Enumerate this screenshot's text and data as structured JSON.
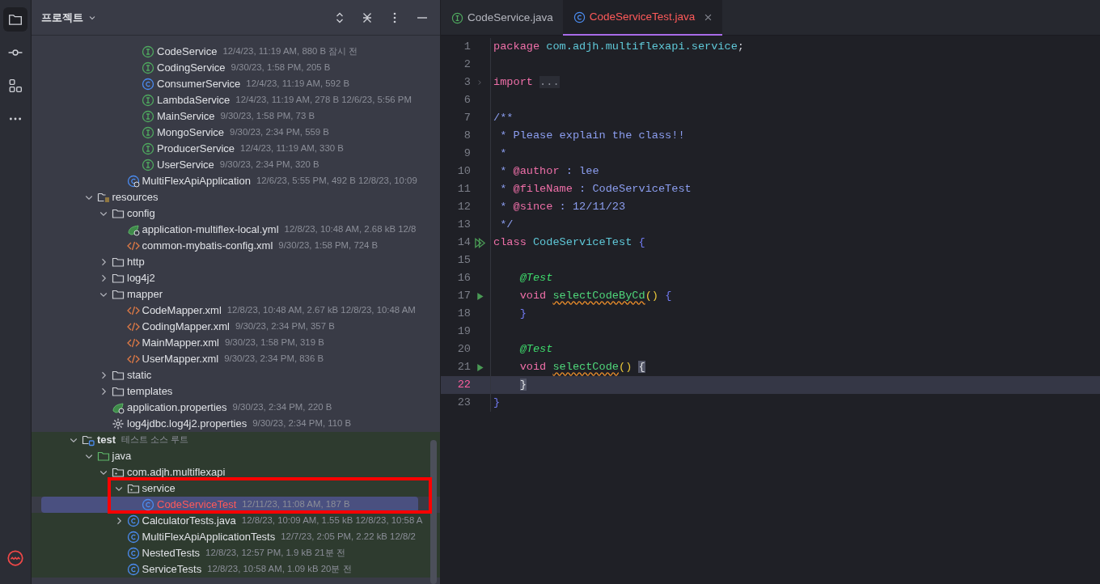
{
  "toolstrip": {
    "items": [
      {
        "selected": true
      },
      {
        "selected": false
      },
      {
        "selected": false
      },
      {
        "selected": false
      }
    ]
  },
  "project_panel": {
    "title": "프로젝트",
    "tree": [
      {
        "children": [
          {
            "children": [
              {
                "children": [
                  {
                    "children": [
                      {
                        "label": "CodeService",
                        "meta": "12/4/23, 11:19 AM, 880 B 잠시 전",
                        "kind": "interface",
                        "selected": false
                      },
                      {
                        "label": "CodingService",
                        "meta": "9/30/23, 1:58 PM, 205 B",
                        "kind": "interface",
                        "selected": false
                      },
                      {
                        "label": "ConsumerService",
                        "meta": "12/4/23, 11:19 AM, 592 B",
                        "kind": "class",
                        "selected": false
                      },
                      {
                        "label": "LambdaService",
                        "meta": "12/4/23, 11:19 AM, 278 B 12/6/23, 5:56 PM",
                        "kind": "interface",
                        "selected": false
                      },
                      {
                        "label": "MainService",
                        "meta": "9/30/23, 1:58 PM, 73 B",
                        "kind": "interface",
                        "selected": false
                      },
                      {
                        "label": "MongoService",
                        "meta": "9/30/23, 2:34 PM, 559 B",
                        "kind": "interface",
                        "selected": false
                      },
                      {
                        "label": "ProducerService",
                        "meta": "12/4/23, 11:19 AM, 330 B",
                        "kind": "interface",
                        "selected": false
                      },
                      {
                        "label": "UserService",
                        "meta": "9/30/23, 2:34 PM, 320 B",
                        "kind": "interface",
                        "selected": false
                      }
                    ]
                  },
                  {
                    "label": "MultiFlexApiApplication",
                    "meta": "12/6/23, 5:55 PM, 492 B 12/8/23, 10:09",
                    "kind": "bootclass",
                    "selected": false
                  }
                ]
              }
            ]
          },
          {
            "label": "resources",
            "kind": "resources",
            "expanded": true,
            "selected": false,
            "children": [
              {
                "label": "config",
                "kind": "folder",
                "expanded": true,
                "selected": false,
                "children": [
                  {
                    "label": "application-multiflex-local.yml",
                    "meta": "12/8/23, 10:48 AM, 2.68 kB 12/8",
                    "kind": "springconfig",
                    "selected": false
                  },
                  {
                    "label": "common-mybatis-config.xml",
                    "meta": "9/30/23, 1:58 PM, 724 B",
                    "kind": "xml",
                    "selected": false
                  }
                ]
              },
              {
                "label": "http",
                "kind": "folder",
                "expanded": false,
                "selected": false
              },
              {
                "label": "log4j2",
                "kind": "folder",
                "expanded": false,
                "selected": false
              },
              {
                "label": "mapper",
                "kind": "folder",
                "expanded": true,
                "selected": false,
                "children": [
                  {
                    "label": "CodeMapper.xml",
                    "meta": "12/8/23, 10:48 AM, 2.67 kB 12/8/23, 10:48 AM",
                    "kind": "xml",
                    "selected": false
                  },
                  {
                    "label": "CodingMapper.xml",
                    "meta": "9/30/23, 2:34 PM, 357 B",
                    "kind": "xml",
                    "selected": false
                  },
                  {
                    "label": "MainMapper.xml",
                    "meta": "9/30/23, 1:58 PM, 319 B",
                    "kind": "xml",
                    "selected": false
                  },
                  {
                    "label": "UserMapper.xml",
                    "meta": "9/30/23, 2:34 PM, 836 B",
                    "kind": "xml",
                    "selected": false
                  }
                ]
              },
              {
                "label": "static",
                "kind": "folder",
                "expanded": false,
                "selected": false
              },
              {
                "label": "templates",
                "kind": "folder",
                "expanded": false,
                "selected": false
              },
              {
                "label": "application.properties",
                "meta": "9/30/23, 2:34 PM, 220 B",
                "kind": "springconfig",
                "selected": false
              },
              {
                "label": "log4jdbc.log4j2.properties",
                "meta": "9/30/23, 2:34 PM, 110 B",
                "kind": "properties",
                "selected": false
              }
            ]
          }
        ]
      },
      {
        "label": "test",
        "meta": "테스트 소스 루트",
        "kind": "testroot",
        "expanded": true,
        "selected": false,
        "children": [
          {
            "label": "java",
            "kind": "source",
            "expanded": true,
            "selected": false,
            "children": [
              {
                "label": "com.adjh.multiflexapi",
                "kind": "package",
                "expanded": true,
                "selected": false,
                "children": [
                  {
                    "label": "service",
                    "kind": "package",
                    "expanded": true,
                    "selected": false,
                    "framed": true,
                    "children": [
                      {
                        "label": "CodeServiceTest",
                        "meta": "12/11/23, 11:08 AM, 187 B",
                        "kind": "class",
                        "selected": true,
                        "added": true
                      }
                    ]
                  },
                  {
                    "label": "CalculatorTests.java",
                    "meta": "12/8/23, 10:09 AM, 1.55 kB 12/8/23, 10:58 A",
                    "kind": "class",
                    "expanded": false,
                    "selected": false
                  },
                  {
                    "label": "MultiFlexApiApplicationTests",
                    "meta": "12/7/23, 2:05 PM, 2.22 kB 12/8/2",
                    "kind": "class",
                    "selected": false
                  },
                  {
                    "label": "NestedTests",
                    "meta": "12/8/23, 12:57 PM, 1.9 kB 21분 전",
                    "kind": "class",
                    "selected": false
                  },
                  {
                    "label": "ServiceTests",
                    "meta": "12/8/23, 10:58 AM, 1.09 kB 20분 전",
                    "kind": "class",
                    "selected": false
                  }
                ]
              }
            ]
          }
        ]
      }
    ]
  },
  "editor": {
    "tabs": [
      {
        "label": "CodeService.java",
        "kind": "interface",
        "selected": false
      },
      {
        "label": "CodeServiceTest.java",
        "kind": "class",
        "selected": true,
        "added": true,
        "closable": true
      }
    ],
    "lines": [
      {
        "n": "1",
        "tokens": [
          {
            "kind": "keyword",
            "text": "package "
          },
          {
            "kind": "name",
            "text": "com.adjh.multiflexapi.service"
          },
          {
            "kind": "plain",
            "text": ";"
          }
        ]
      },
      {
        "n": "2"
      },
      {
        "n": "3",
        "kind": "fold",
        "tokens": [
          {
            "kind": "keyword",
            "text": "import "
          },
          {
            "kind": "folded",
            "text": "..."
          }
        ]
      },
      {
        "n": "6"
      },
      {
        "n": "7",
        "tokens": [
          {
            "kind": "comment",
            "text": "/**"
          }
        ]
      },
      {
        "n": "8",
        "tokens": [
          {
            "kind": "comment",
            "text": " * Please explain the class!!"
          }
        ]
      },
      {
        "n": "9",
        "tokens": [
          {
            "kind": "comment",
            "text": " *"
          }
        ]
      },
      {
        "n": "10",
        "tokens": [
          {
            "kind": "comment",
            "text": " * "
          },
          {
            "kind": "doctag",
            "text": "@author"
          },
          {
            "kind": "comment",
            "text": " : lee"
          }
        ]
      },
      {
        "n": "11",
        "tokens": [
          {
            "kind": "comment",
            "text": " * "
          },
          {
            "kind": "doctag",
            "text": "@fileName"
          },
          {
            "kind": "comment",
            "text": " : CodeServiceTest"
          }
        ]
      },
      {
        "n": "12",
        "tokens": [
          {
            "kind": "comment",
            "text": " * "
          },
          {
            "kind": "doctag",
            "text": "@since"
          },
          {
            "kind": "comment",
            "text": " : 12/11/23"
          }
        ]
      },
      {
        "n": "13",
        "tokens": [
          {
            "kind": "comment",
            "text": " */"
          }
        ]
      },
      {
        "n": "14",
        "kind": "runall",
        "tokens": [
          {
            "kind": "keyword",
            "text": "class "
          },
          {
            "kind": "name",
            "text": "CodeServiceTest "
          },
          {
            "kind": "brace",
            "text": "{"
          }
        ]
      },
      {
        "n": "15"
      },
      {
        "n": "16",
        "tokens": [
          {
            "kind": "annotation",
            "text": "    @Test"
          }
        ]
      },
      {
        "n": "17",
        "kind": "run",
        "tokens": [
          {
            "kind": "keyword",
            "text": "    void "
          },
          {
            "kind": "warning",
            "text": "selectCodeByCd"
          },
          {
            "kind": "paren",
            "text": "() "
          },
          {
            "kind": "brace",
            "text": "{"
          }
        ]
      },
      {
        "n": "18",
        "tokens": [
          {
            "kind": "brace",
            "text": "    }"
          }
        ]
      },
      {
        "n": "19"
      },
      {
        "n": "20",
        "tokens": [
          {
            "kind": "annotation",
            "text": "    @Test"
          }
        ]
      },
      {
        "n": "21",
        "kind": "run",
        "tokens": [
          {
            "kind": "keyword",
            "text": "    void "
          },
          {
            "kind": "warning",
            "text": "selectCode"
          },
          {
            "kind": "paren",
            "text": "() "
          },
          {
            "kind": "match",
            "text": "{"
          }
        ]
      },
      {
        "n": "22",
        "current": true,
        "tokens": [
          {
            "kind": "match",
            "text": "    }"
          }
        ]
      },
      {
        "n": "23",
        "tokens": [
          {
            "kind": "brace",
            "text": "}"
          }
        ]
      }
    ]
  }
}
